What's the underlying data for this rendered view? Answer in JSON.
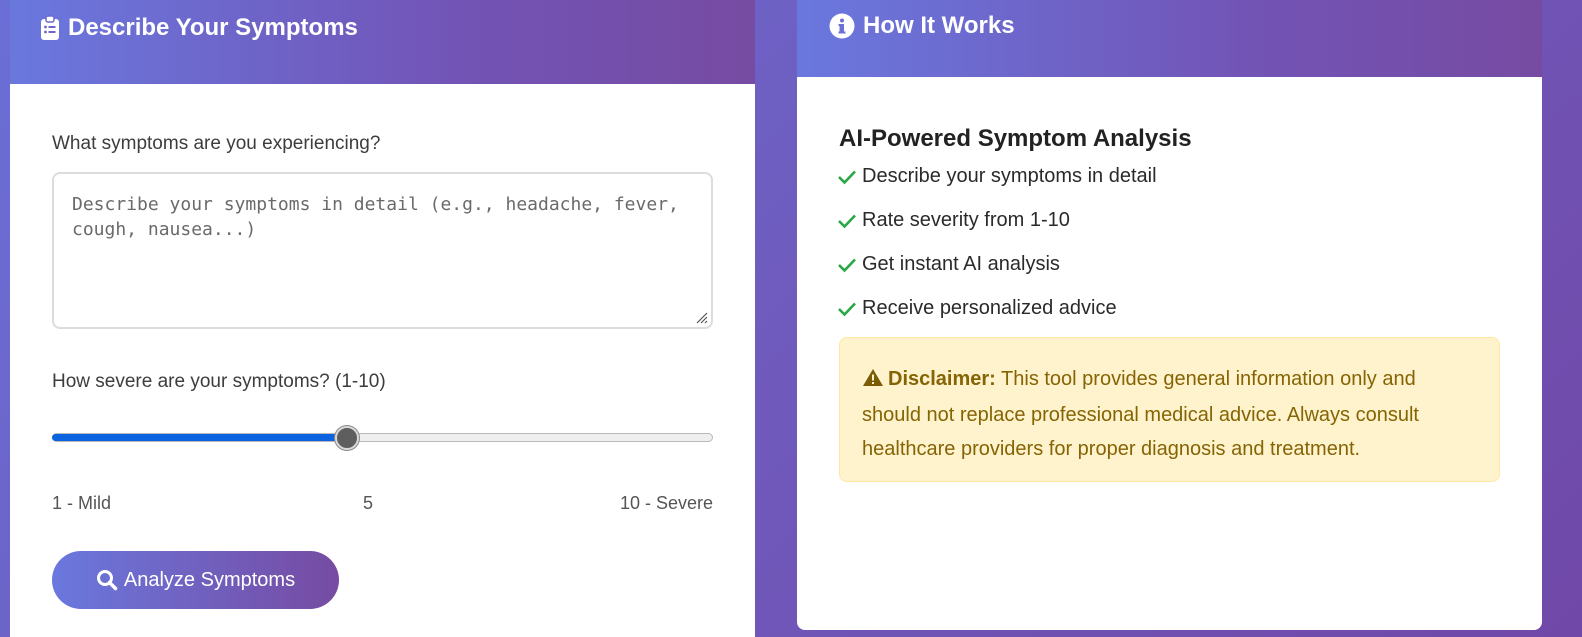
{
  "left_card": {
    "title": "Describe Your Symptoms",
    "icon": "clipboard-icon",
    "symptoms_label": "What symptoms are you experiencing?",
    "symptoms_placeholder": "Describe your symptoms in detail (e.g., headache, fever, cough, nausea...)",
    "symptoms_value": "",
    "severity_label": "How severe are your symptoms? (1-10)",
    "severity": {
      "min": 1,
      "max": 10,
      "value": 5
    },
    "scale_min_label": "1 - Mild",
    "scale_mid_label": "5",
    "scale_max_label": "10 - Severe",
    "analyze_button": "Analyze Symptoms",
    "analyze_icon": "search-icon"
  },
  "right_card": {
    "title": "How It Works",
    "icon": "info-circle-icon",
    "subtitle": "AI-Powered Symptom Analysis",
    "steps": [
      "Describe your symptoms in detail",
      "Rate severity from 1-10",
      "Get instant AI analysis",
      "Receive personalized advice"
    ],
    "disclaimer_label": "Disclaimer:",
    "disclaimer_text": " This tool provides general information only and should not replace professional medical advice. Always consult healthcare providers for proper diagnosis and treatment.",
    "disclaimer_icon": "warning-icon"
  },
  "colors": {
    "header_gradient_start": "#6a78de",
    "header_gradient_end": "#764ba2",
    "slider_fill": "#0b63e0",
    "check": "#28a745",
    "disclaimer_bg": "#fff3cd",
    "disclaimer_text": "#856404"
  }
}
